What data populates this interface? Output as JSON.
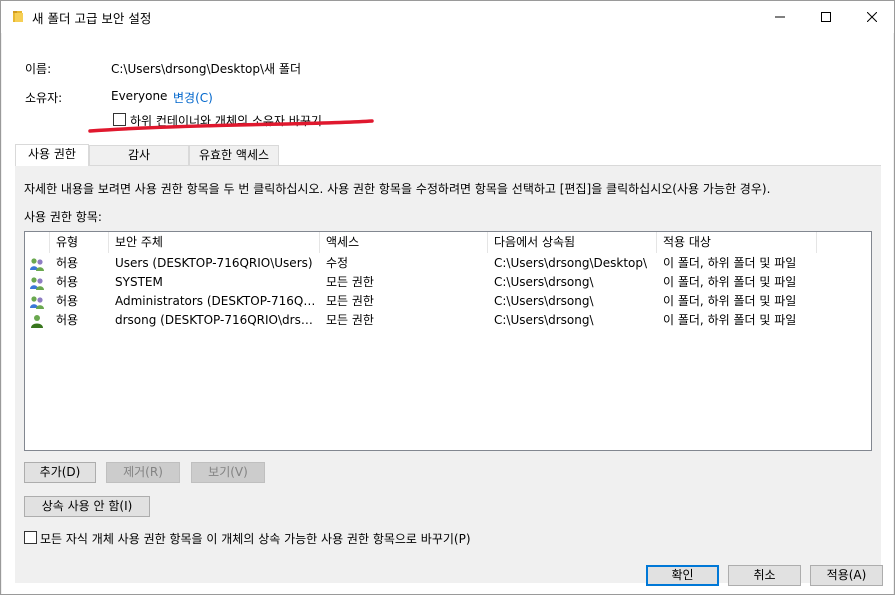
{
  "window": {
    "title": "새 폴더 고급 보안 설정",
    "minimize_label": "",
    "maximize_label": "",
    "close_label": ""
  },
  "name_row": {
    "label": "이름:",
    "value": "C:\\Users\\drsong\\Desktop\\새 폴더"
  },
  "owner_row": {
    "label": "소유자:",
    "value": "Everyone",
    "change_link": "변경(C)",
    "replace_owner_checkbox": {
      "label": "하위 컨테이너와 개체의 소유자 바꾸기",
      "checked": false
    }
  },
  "annotation": {
    "color": "#e0182e"
  },
  "tabs": [
    {
      "label": "사용 권한",
      "active": true
    },
    {
      "label": "감사",
      "active": false
    },
    {
      "label": "유효한 액세스",
      "active": false
    }
  ],
  "permissions": {
    "instruction": "자세한 내용을 보려면 사용 권한 항목을 두 번 클릭하십시오. 사용 권한 항목을 수정하려면 항목을 선택하고 [편집]을 클릭하십시오(사용 가능한 경우).",
    "entries_label": "사용 권한 항목:",
    "columns": [
      "유형",
      "보안 주체",
      "액세스",
      "다음에서 상속됨",
      "적용 대상"
    ],
    "rows": [
      {
        "icon": "group-users-icon",
        "type": "허용",
        "principal": "Users (DESKTOP-716QRIO\\Users)",
        "access": "수정",
        "inherited_from": "C:\\Users\\drsong\\Desktop\\",
        "applies_to": "이 폴더, 하위 폴더 및 파일"
      },
      {
        "icon": "group-users-icon",
        "type": "허용",
        "principal": "SYSTEM",
        "access": "모든 권한",
        "inherited_from": "C:\\Users\\drsong\\",
        "applies_to": "이 폴더, 하위 폴더 및 파일"
      },
      {
        "icon": "group-users-icon",
        "type": "허용",
        "principal": "Administrators (DESKTOP-716QRI...",
        "access": "모든 권한",
        "inherited_from": "C:\\Users\\drsong\\",
        "applies_to": "이 폴더, 하위 폴더 및 파일"
      },
      {
        "icon": "single-user-icon",
        "type": "허용",
        "principal": "drsong (DESKTOP-716QRIO\\drson...",
        "access": "모든 권한",
        "inherited_from": "C:\\Users\\drsong\\",
        "applies_to": "이 폴더, 하위 폴더 및 파일"
      }
    ],
    "buttons": {
      "add": "추가(D)",
      "remove": "제거(R)",
      "view": "보기(V)",
      "disable_inheritance": "상속 사용 안 함(I)"
    },
    "replace_child_checkbox": {
      "label": "모든 자식 개체 사용 권한 항목을 이 개체의 상속 가능한 사용 권한 항목으로 바꾸기(P)",
      "checked": false
    }
  },
  "dialog_buttons": {
    "ok": "확인",
    "cancel": "취소",
    "apply": "적용(A)"
  }
}
